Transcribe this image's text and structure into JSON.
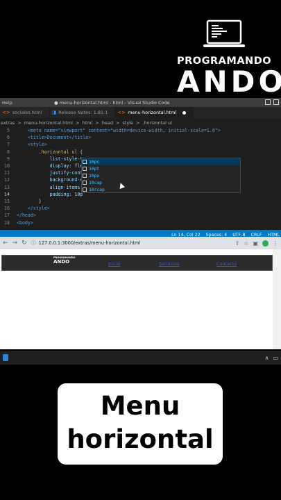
{
  "brand": {
    "line1": "PROGRAMANDO",
    "line2": "ANDO"
  },
  "vscode": {
    "menu_label": "Help",
    "window_title": "● menu-horizontal.html - html - Visual Studio Code",
    "tabs": [
      {
        "label": "sociales.html",
        "icon": "html-icon"
      },
      {
        "label": "Release Notes: 1.81.1",
        "icon": "vscode-icon"
      },
      {
        "label": "menu-horizontal.html",
        "icon": "html-icon",
        "active": true,
        "dirty": true
      }
    ],
    "breadcrumbs": [
      "extras",
      ">",
      "menu-horizontal.html",
      ">",
      "html",
      ">",
      "head",
      ">",
      "style",
      ">",
      ".horizontal ul"
    ],
    "lines": [
      {
        "num": "5",
        "text": "    <meta name=\"viewport\" content=\"width=device-width, initial-scale=1.0\">"
      },
      {
        "num": "6",
        "text": "    <title>Document</title>"
      },
      {
        "num": "7",
        "text": "    <style>"
      },
      {
        "num": "8",
        "text": "        .horizontal ul {"
      },
      {
        "num": "9",
        "text": "            list-style-ty"
      },
      {
        "num": "10",
        "text": "            display: flex"
      },
      {
        "num": "11",
        "text": "            justify-conte"
      },
      {
        "num": "12",
        "text": "            background-co"
      },
      {
        "num": "13",
        "text": "            align-items:"
      },
      {
        "num": "14",
        "text": "            padding: 10p"
      },
      {
        "num": "15",
        "text": "        }"
      },
      {
        "num": "16",
        "text": "    </style>"
      },
      {
        "num": "17",
        "text": "</head>"
      },
      {
        "num": "18",
        "text": "<body>"
      }
    ],
    "suggestions": [
      "10pc",
      "10pt",
      "10px",
      "10cap",
      "10rcap"
    ],
    "status": [
      "Ln 14, Col 22",
      "Spaces: 4",
      "UTF-8",
      "CRLF",
      "HTML"
    ]
  },
  "browser": {
    "url": "127.0.0.1:3000/extras/menu-horizontal.html",
    "site_logo": {
      "line1": "PROGRAMANDO",
      "line2": "ANDO"
    },
    "nav_links": [
      "Inicio",
      "Servicios",
      "Contacto"
    ]
  },
  "caption": {
    "line1": "Menu",
    "line2": "horizontal"
  }
}
